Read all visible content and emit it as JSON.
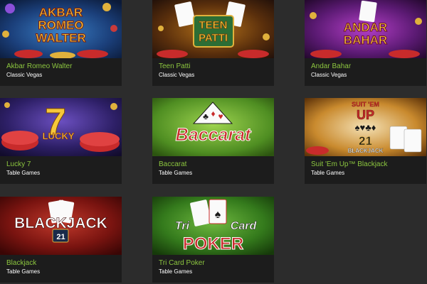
{
  "games": [
    {
      "title_lines": [
        "AKBAR",
        "ROMEO",
        "WALTER"
      ],
      "name": "Akbar Romeo Walter",
      "category": "Classic Vegas"
    },
    {
      "title_lines": [
        "TEEN",
        "PATTI"
      ],
      "name": "Teen Patti",
      "category": "Classic Vegas"
    },
    {
      "title_lines": [
        "ANDAR",
        "BAHAR"
      ],
      "name": "Andar Bahar",
      "category": "Classic Vegas"
    },
    {
      "title_lines": [
        "7",
        "LUCKY"
      ],
      "name": "Lucky 7",
      "category": "Table Games"
    },
    {
      "title_lines": [
        "Baccarat"
      ],
      "name": "Baccarat",
      "category": "Table Games"
    },
    {
      "title_lines": [
        "SUIT 'EM",
        "UP",
        "21",
        "BLACKJACK"
      ],
      "name": "Suit 'Em Up™ Blackjack",
      "category": "Table Games"
    },
    {
      "title_lines": [
        "BLACK",
        "JACK",
        "21"
      ],
      "name": "Blackjack",
      "category": "Table Games"
    },
    {
      "title_lines": [
        "Tri",
        "Card",
        "POKER"
      ],
      "name": "Tri Card Poker",
      "category": "Table Games"
    }
  ],
  "colors": {
    "page_background": "#2c2c2c",
    "tile_background": "#1c1c1c",
    "game_name": "#8cc63f",
    "category": "#ffffff"
  }
}
